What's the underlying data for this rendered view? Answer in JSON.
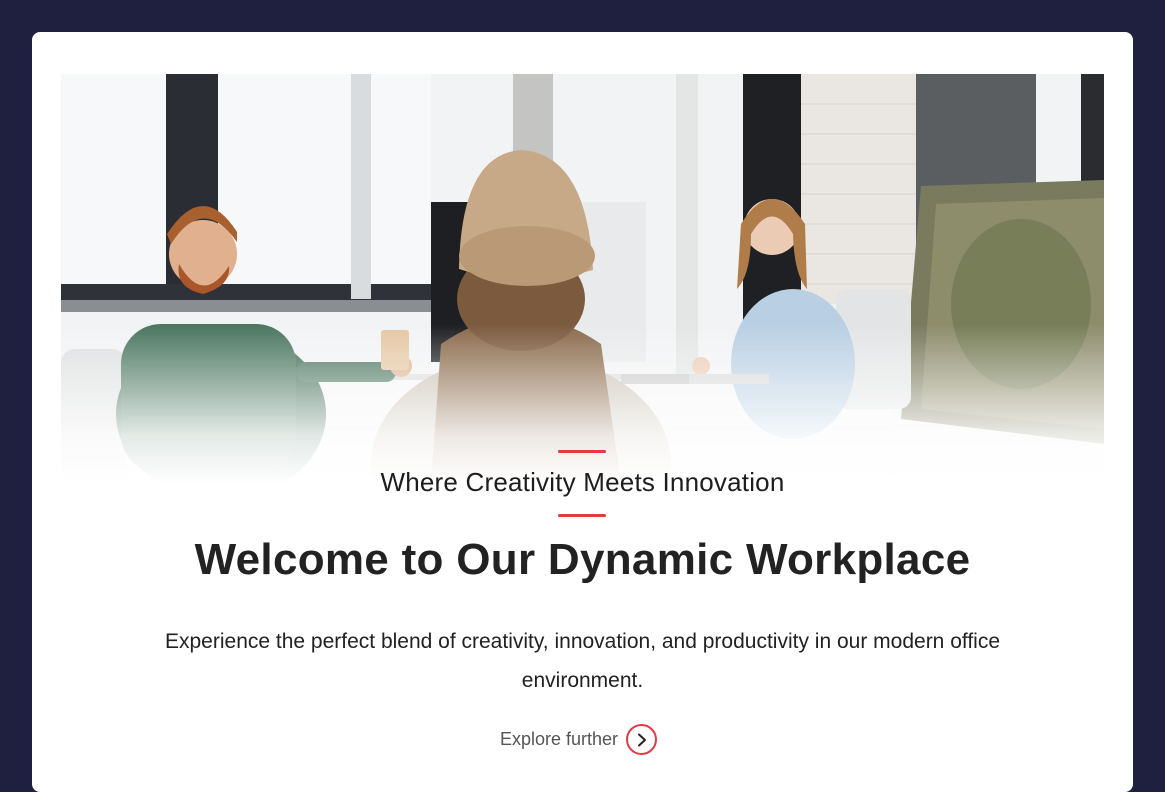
{
  "colors": {
    "page_background": "#1f1f3f",
    "card_background": "#ffffff",
    "accent": "#e63946",
    "text_dark": "#222222",
    "text_muted": "#555555"
  },
  "hero": {
    "image_description": "photo-office-coworkers"
  },
  "content": {
    "tagline": "Where Creativity Meets Innovation",
    "title": "Welcome to Our Dynamic Workplace",
    "description": "Experience the perfect blend of creativity, innovation, and productivity in our modern office environment.",
    "cta_label": "Explore further",
    "cta_icon": "chevron-right-icon"
  }
}
